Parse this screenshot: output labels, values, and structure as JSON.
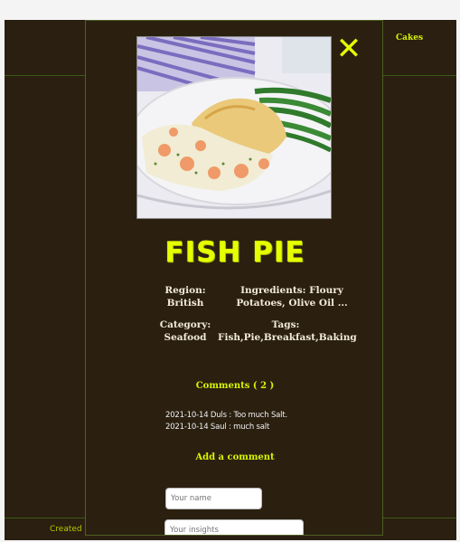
{
  "background": {
    "nav": {
      "cakes": "Cakes"
    },
    "footer": {
      "text": "Created b"
    }
  },
  "modal": {
    "close_glyph": "✕",
    "recipe": {
      "title": "FISH PIE",
      "region_label": "Region:",
      "region_value": "British",
      "ingredients_label": "Ingredients: Floury",
      "ingredients_value": "Potatoes, Olive Oil ...",
      "category_label": "Category:",
      "category_value": "Seafood",
      "tags_label": "Tags:",
      "tags_value": "Fish,Pie,Breakfast,Baking"
    },
    "comments": {
      "title": "Comments ( 2 )",
      "items": [
        "2021-10-14 Duls : Too much Salt.",
        "2021-10-14 Saul : much salt"
      ]
    },
    "add_comment": {
      "title": "Add a comment",
      "name_placeholder": "Your name",
      "insights_placeholder": "Your insights"
    }
  },
  "colors": {
    "accent": "#e6ff00",
    "background": "#2a1f10",
    "text": "#f2ead8"
  }
}
